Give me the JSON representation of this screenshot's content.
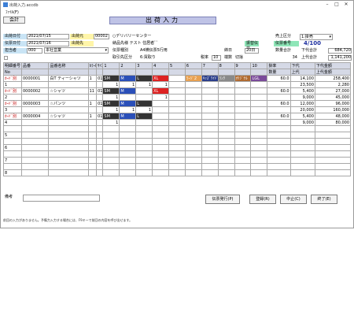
{
  "window": {
    "title": "出荷入力.accdb"
  },
  "menu": {
    "file": "ﾌｧｲﾙ(F)"
  },
  "accounting_button": "会計",
  "screen_title": "出荷入力",
  "header": {
    "ship_date_label": "出荷日付",
    "ship_date": "2021/07/15",
    "shipper_label": "出荷元",
    "shipper_code": "00002",
    "shipper_name": "○デリバリーセンター",
    "pay_date_label": "伝票日付",
    "pay_date": "2021/07/16",
    "dest_label": "出荷先",
    "dest_name": "納品先様 テスト 住居者ﾞﾞ",
    "sales_type_label": "売上区分",
    "sales_type": "1:掛売",
    "warehouse_label": "担当者",
    "warehouse_code": "000",
    "warehouse_name": "本社営業",
    "slip_type_label": "伝票種別",
    "slip_type": "A4横伝票5行用",
    "payment_label": "入金先",
    "slip_no_label": "伝票番号",
    "slip_no": "4/100",
    "transfer_label": "振替伝票",
    "sales_category_label": "取引先区分",
    "sales_category": "6:買取り",
    "tax_label": "税率",
    "tax_value": "10",
    "tax_rate_label": "端数",
    "tax_round": "切捨",
    "due_label": "締日",
    "due_value": "20日",
    "cutoff_label": "締日",
    "cutoff_value": "30",
    "cutoff_unit": "日",
    "qty_total_label": "数量合計",
    "qty_total": "34",
    "amount_label": "下代合計",
    "amount_total": "684,720",
    "retail_label": "上代合計",
    "retail_total": "1,141,200"
  },
  "grid": {
    "headers_row1": [
      "明細番号",
      "品番",
      "品番名称",
      "ｶﾗｰNo",
      "ｻｲｽﾞ",
      "1",
      "2",
      "3",
      "4",
      "5",
      "6",
      "7",
      "8",
      "9",
      "10",
      "掛率",
      "下代",
      "下代金額"
    ],
    "headers_row2": [
      "No",
      "",
      "",
      "",
      "",
      "",
      "",
      "",
      "",
      "",
      "",
      "",
      "",
      "",
      "",
      "数量",
      "上代",
      "上代金額"
    ],
    "rows": [
      {
        "no": "1",
        "kind": "ｶｰﾄﾞ別",
        "code": "0000001",
        "name": "白T ティーシャツ",
        "color": "1",
        "size": "01",
        "cells": [
          "SM",
          "M",
          "L",
          "XL",
          "",
          "ﾗｰｼﾞ2",
          "ｷｯｽﾞﾜｲﾄﾞ",
          "ﾗﾝｸ",
          "ｵﾘｼﾞﾅﾙ",
          "LGL"
        ],
        "qty": [
          "1",
          "1",
          "1",
          "1",
          "",
          "",
          "",
          "",
          "",
          ""
        ],
        "rate": "60.0",
        "price": "14,100",
        "amount": "258,400",
        "retail": "23,500",
        "retail_amt": "2,280"
      },
      {
        "no": "2",
        "kind": "ｶｰﾄﾞ別",
        "code": "0000002",
        "name": "☆シャツ",
        "color": "11",
        "size": "01",
        "cells": [
          "SM",
          "M",
          "",
          "XL",
          "",
          "",
          "",
          "",
          "",
          ""
        ],
        "qty": [
          "1",
          "",
          "",
          "1",
          "",
          "",
          "",
          "",
          "",
          ""
        ],
        "rate": "60.0",
        "price": "5,400",
        "amount": "27,000",
        "retail": "9,000",
        "retail_amt": "45,000"
      },
      {
        "no": "3",
        "kind": "ｶｰﾄﾞ別",
        "code": "0000003",
        "name": "☆パンツ",
        "color": "1",
        "size": "01",
        "cells": [
          "SM",
          "M",
          "L",
          "",
          "",
          "",
          "",
          "",
          "",
          ""
        ],
        "qty": [
          "1",
          "1",
          "1",
          "",
          "",
          "",
          "",
          "",
          "",
          ""
        ],
        "rate": "60.0",
        "price": "12,000",
        "amount": "96,000",
        "retail": "20,000",
        "retail_amt": "160,000"
      },
      {
        "no": "4",
        "kind": "ｶｰﾄﾞ別",
        "code": "0000004",
        "name": "☆シャツ",
        "color": "1",
        "size": "01",
        "cells": [
          "SM",
          "M",
          "L",
          "",
          "",
          "",
          "",
          "",
          "",
          ""
        ],
        "qty": [
          "1",
          "",
          "",
          "",
          "",
          "",
          "",
          "",
          "",
          ""
        ],
        "rate": "60.0",
        "price": "5,400",
        "amount": "48,000",
        "retail": "9,000",
        "retail_amt": "80,000"
      }
    ],
    "empty_rows": [
      "5",
      "6",
      "7",
      "8"
    ]
  },
  "remarks_label": "備考",
  "buttons": {
    "print_slip": "伝票発行(P)",
    "register": "登録(R)",
    "cancel": "中止(C)",
    "close": "終了(E)"
  },
  "status_text": "前回の入力がありません。予備力入力する場合には、F9キーで前回の内容を呼び出せます。"
}
